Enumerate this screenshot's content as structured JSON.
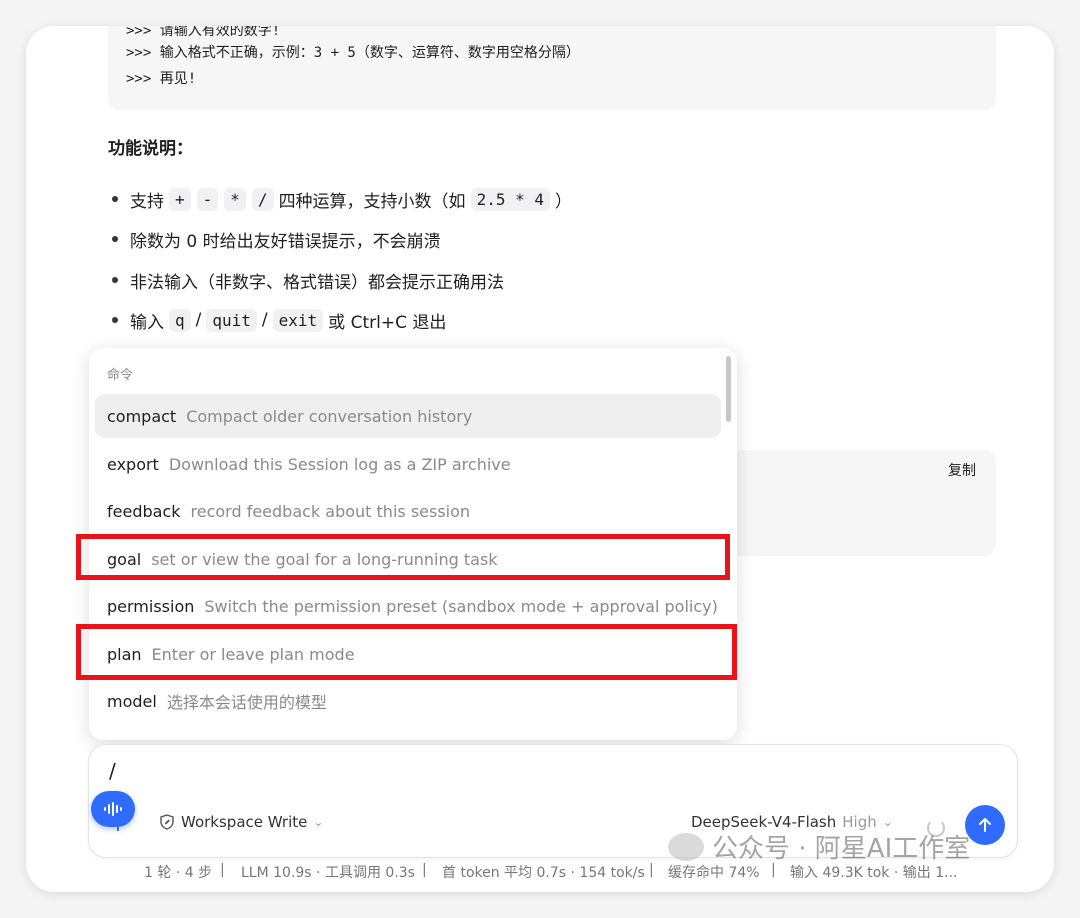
{
  "code_lines": [
    ">>> 请输入有效的数字!",
    ">>> 输入格式不正确，示例：3 + 5（数字、运算符、数字用空格分隔）",
    ">>> 再见!"
  ],
  "section": {
    "heading": "功能说明：",
    "bullets": {
      "b1": {
        "t1": "支持",
        "c1": "+",
        "c2": "-",
        "c3": "*",
        "c4": "/",
        "t2": "四种运算，支持小数（如",
        "c5": "2.5 * 4",
        "t3": "）"
      },
      "b2": {
        "t1": "除数为 0 时给出友好错误提示，不会崩溃"
      },
      "b3": {
        "t1": "非法输入（非数字、格式错误）都会提示正确用法"
      },
      "b4": {
        "t1": "输入",
        "c1": "q",
        "s1": "/",
        "c2": "quit",
        "s2": "/",
        "c3": "exit",
        "t2": "或 Ctrl+C 退出"
      }
    }
  },
  "copy_label": "复制",
  "command_popup": {
    "title": "命令",
    "items": [
      {
        "name": "compact",
        "desc": "Compact older conversation history"
      },
      {
        "name": "export",
        "desc": "Download this Session log as a ZIP archive"
      },
      {
        "name": "feedback",
        "desc": "record feedback about this session"
      },
      {
        "name": "goal",
        "desc": "set or view the goal for a long-running task"
      },
      {
        "name": "permission",
        "desc": "Switch the permission preset (sandbox mode + approval policy)"
      },
      {
        "name": "plan",
        "desc": "Enter or leave plan mode"
      },
      {
        "name": "model",
        "desc": "选择本会话使用的模型"
      }
    ],
    "active_item": "compact",
    "highlighted_items": [
      "goal",
      "plan"
    ],
    "highlight_color": "#e8141a"
  },
  "composer": {
    "input_value": "/",
    "mode_label": "Workspace Write",
    "model_name": "DeepSeek-V4-Flash",
    "model_level": "High",
    "accent_color": "#2f6bff"
  },
  "statusbar": {
    "s1": "1 轮 · 4 步",
    "s2": "LLM 10.9s · 工具调用 0.3s",
    "s3": "首 token 平均 0.7s · 154 tok/s",
    "s4": "缓存命中 74%",
    "s5": "输入 49.3K tok · 输出 1...",
    "sep": "|"
  },
  "watermark": "公众号 · 阿星AI工作室"
}
